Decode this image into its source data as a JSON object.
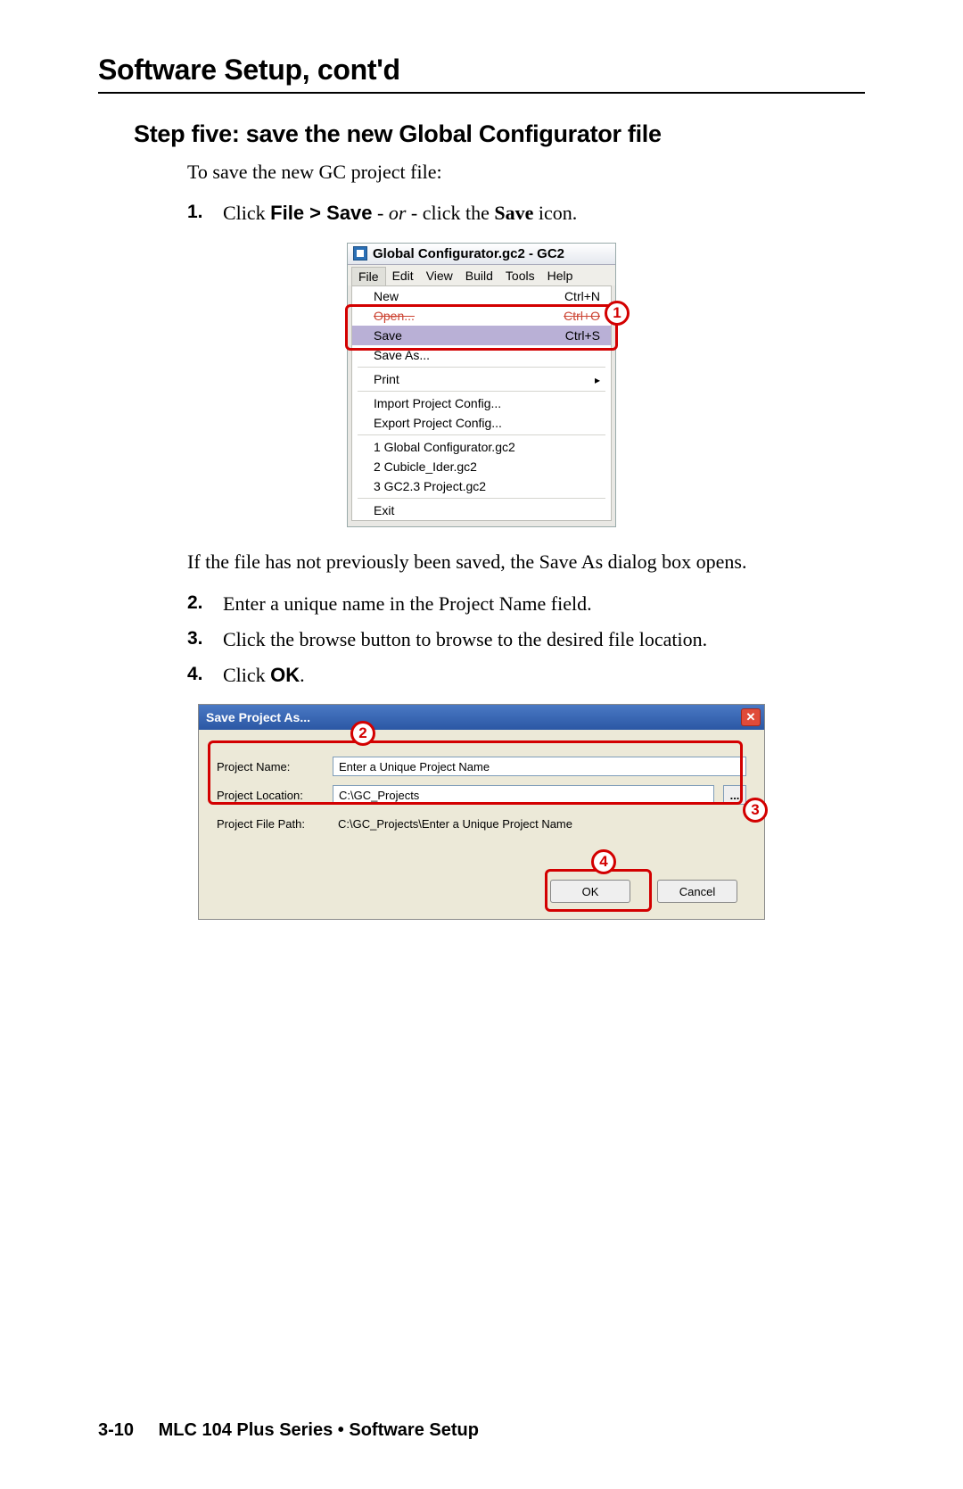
{
  "header": "Software Setup, cont'd",
  "step_heading": "Step five: save the new Global Configurator file",
  "intro": "To save the new GC project file:",
  "steps": {
    "s1": {
      "num": "1.",
      "a": "Click ",
      "b": "File > Save",
      "c": " - ",
      "d": "or",
      "e": " - click the ",
      "f": "Save",
      "g": " icon."
    },
    "para": "If the file has not previously been saved, the Save As dialog box opens.",
    "s2": {
      "num": "2.",
      "text": "Enter a unique name in the Project Name field."
    },
    "s3": {
      "num": "3.",
      "text": "Click the browse button to browse to the desired file location."
    },
    "s4": {
      "num": "4.",
      "a": "Click ",
      "b": "OK",
      "c": "."
    }
  },
  "shot1": {
    "title": "Global Configurator.gc2 - GC2",
    "menubar": [
      "File",
      "Edit",
      "View",
      "Build",
      "Tools",
      "Help"
    ],
    "items": {
      "new": {
        "label": "New",
        "accel": "Ctrl+N"
      },
      "open": {
        "label": "Open...",
        "accel": "Ctrl+O"
      },
      "save": {
        "label": "Save",
        "accel": "Ctrl+S"
      },
      "saveas": {
        "label": "Save As..."
      },
      "print": {
        "label": "Print"
      },
      "import": {
        "label": "Import Project Config..."
      },
      "export": {
        "label": "Export Project Config..."
      },
      "recent1": {
        "label": "1 Global Configurator.gc2"
      },
      "recent2": {
        "label": "2 Cubicle_Ider.gc2"
      },
      "recent3": {
        "label": "3 GC2.3 Project.gc2"
      },
      "exit": {
        "label": "Exit"
      }
    },
    "callout": "1"
  },
  "shot2": {
    "title": "Save Project As...",
    "labels": {
      "name": "Project Name:",
      "loc": "Project Location:",
      "path": "Project File Path:"
    },
    "values": {
      "name": "Enter a Unique Project Name",
      "loc": "C:\\GC_Projects",
      "path": "C:\\GC_Projects\\Enter a Unique Project Name"
    },
    "browse": "...",
    "buttons": {
      "ok": "OK",
      "cancel": "Cancel"
    },
    "callouts": {
      "c2": "2",
      "c3": "3",
      "c4": "4"
    }
  },
  "footer": {
    "pnum": "3-10",
    "ptitle": "MLC 104 Plus Series • Software Setup"
  }
}
